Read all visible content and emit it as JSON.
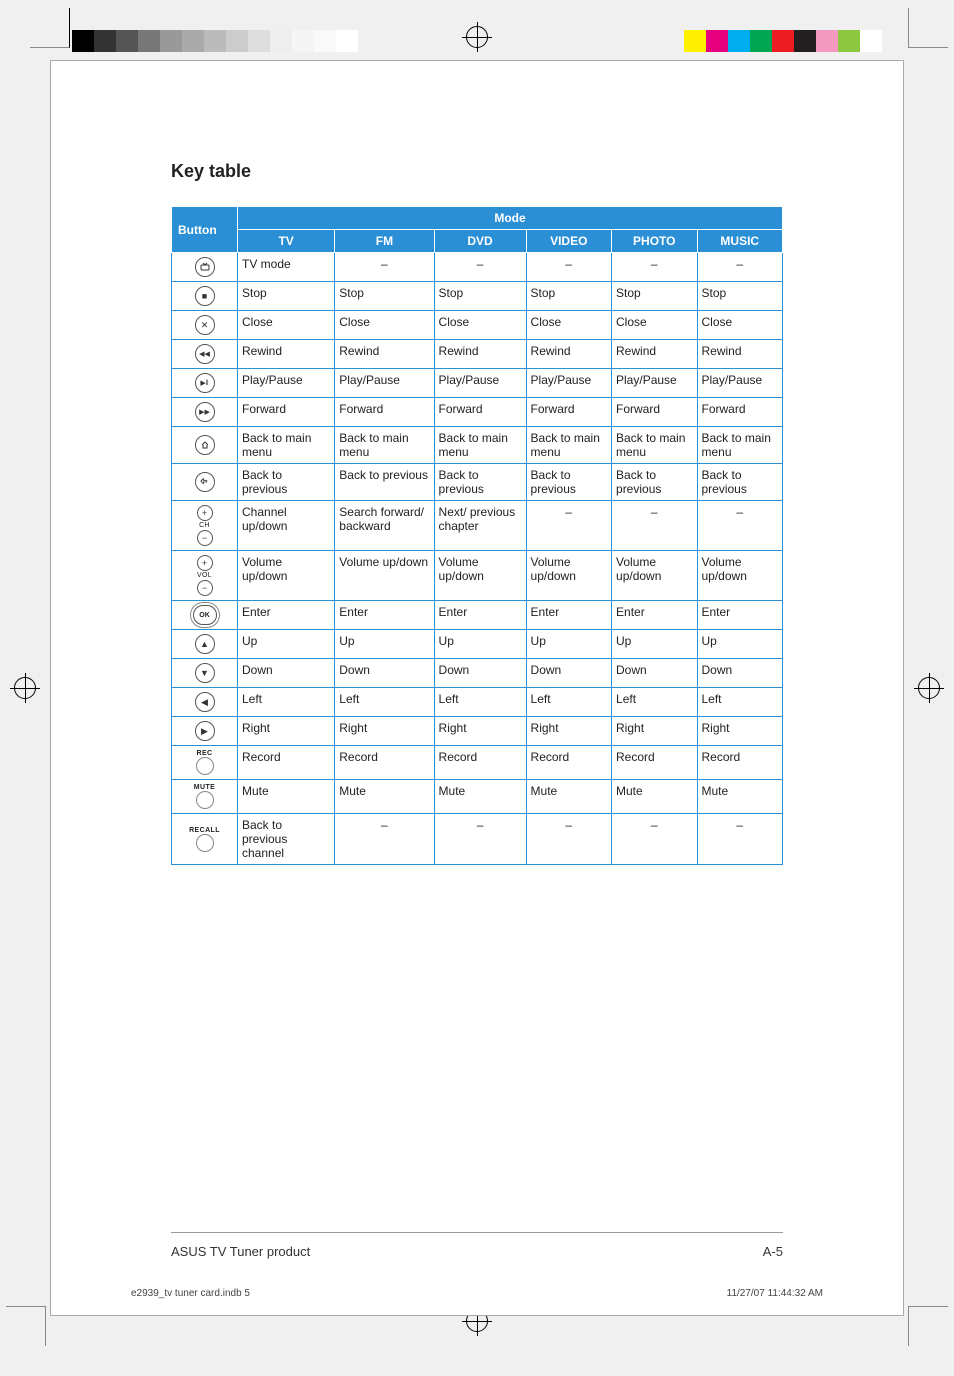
{
  "title": "Key table",
  "header": {
    "button": "Button",
    "mode": "Mode"
  },
  "columns": [
    "TV",
    "FM",
    "DVD",
    "VIDEO",
    "PHOTO",
    "MUSIC"
  ],
  "rows": [
    {
      "icon": "tv-mode-icon",
      "glyph": "tv",
      "cells": [
        "TV mode",
        "–",
        "–",
        "–",
        "–",
        "–"
      ]
    },
    {
      "icon": "stop-icon",
      "glyph": "■",
      "cells": [
        "Stop",
        "Stop",
        "Stop",
        "Stop",
        "Stop",
        "Stop"
      ]
    },
    {
      "icon": "close-icon",
      "glyph": "✕",
      "cells": [
        "Close",
        "Close",
        "Close",
        "Close",
        "Close",
        "Close"
      ]
    },
    {
      "icon": "rewind-icon",
      "glyph": "◀◀",
      "cells": [
        "Rewind",
        "Rewind",
        "Rewind",
        "Rewind",
        "Rewind",
        "Rewind"
      ]
    },
    {
      "icon": "play-pause-icon",
      "glyph": "▶ǁ",
      "cells": [
        "Play/Pause",
        "Play/Pause",
        "Play/Pause",
        "Play/Pause",
        "Play/Pause",
        "Play/Pause"
      ]
    },
    {
      "icon": "forward-icon",
      "glyph": "▶▶",
      "cells": [
        "Forward",
        "Forward",
        "Forward",
        "Forward",
        "Forward",
        "Forward"
      ]
    },
    {
      "icon": "main-menu-icon",
      "glyph": "home",
      "cells": [
        "Back to main menu",
        "Back to main menu",
        "Back to main menu",
        "Back to main menu",
        "Back to main menu",
        "Back to main menu"
      ]
    },
    {
      "icon": "back-icon",
      "glyph": "return",
      "cells": [
        "Back to previous",
        "Back to previous",
        "Back to previous",
        "Back to previous",
        "Back to previous",
        "Back to previous"
      ]
    },
    {
      "icon": "ch-up-down-icon",
      "glyph": "ch",
      "label": "CH",
      "cells": [
        "Channel up/down",
        "Search forward/ backward",
        "Next/ previous chapter",
        "–",
        "–",
        "–"
      ]
    },
    {
      "icon": "vol-up-down-icon",
      "glyph": "vol",
      "label": "VOL",
      "cells": [
        "Volume up/down",
        "Volume up/down",
        "Volume up/down",
        "Volume up/down",
        "Volume up/down",
        "Volume up/down"
      ]
    },
    {
      "icon": "ok-icon",
      "glyph": "OK",
      "cells": [
        "Enter",
        "Enter",
        "Enter",
        "Enter",
        "Enter",
        "Enter"
      ]
    },
    {
      "icon": "up-icon",
      "glyph": "▲",
      "cells": [
        "Up",
        "Up",
        "Up",
        "Up",
        "Up",
        "Up"
      ]
    },
    {
      "icon": "down-icon",
      "glyph": "▼",
      "cells": [
        "Down",
        "Down",
        "Down",
        "Down",
        "Down",
        "Down"
      ]
    },
    {
      "icon": "left-icon",
      "glyph": "◀",
      "cells": [
        "Left",
        "Left",
        "Left",
        "Left",
        "Left",
        "Left"
      ]
    },
    {
      "icon": "right-icon",
      "glyph": "▶",
      "cells": [
        "Right",
        "Right",
        "Right",
        "Right",
        "Right",
        "Right"
      ]
    },
    {
      "icon": "record-icon",
      "glyph": "",
      "label": "REC",
      "cells": [
        "Record",
        "Record",
        "Record",
        "Record",
        "Record",
        "Record"
      ]
    },
    {
      "icon": "mute-icon",
      "glyph": "",
      "label": "MUTE",
      "cells": [
        "Mute",
        "Mute",
        "Mute",
        "Mute",
        "Mute",
        "Mute"
      ]
    },
    {
      "icon": "recall-icon",
      "glyph": "",
      "label": "RECALL",
      "cells": [
        "Back to previous channel",
        "–",
        "–",
        "–",
        "–",
        "–"
      ]
    }
  ],
  "footer": {
    "product": "ASUS TV Tuner product",
    "page": "A-5"
  },
  "imprint": {
    "file": "e2939_tv tuner card.indb   5",
    "stamp": "11/27/07   11:44:32 AM"
  },
  "colorbars": {
    "left": [
      "#000",
      "#333",
      "#555",
      "#777",
      "#999",
      "#aaa",
      "#bbb",
      "#ccc",
      "#ddd",
      "#eee",
      "#f5f5f5",
      "#fafafa",
      "#fff"
    ],
    "right": [
      "#fff000",
      "#e6007e",
      "#00aeef",
      "#00a651",
      "#ed1c24",
      "#231f20",
      "#f49ac1",
      "#8dc63f",
      "#fff"
    ]
  }
}
